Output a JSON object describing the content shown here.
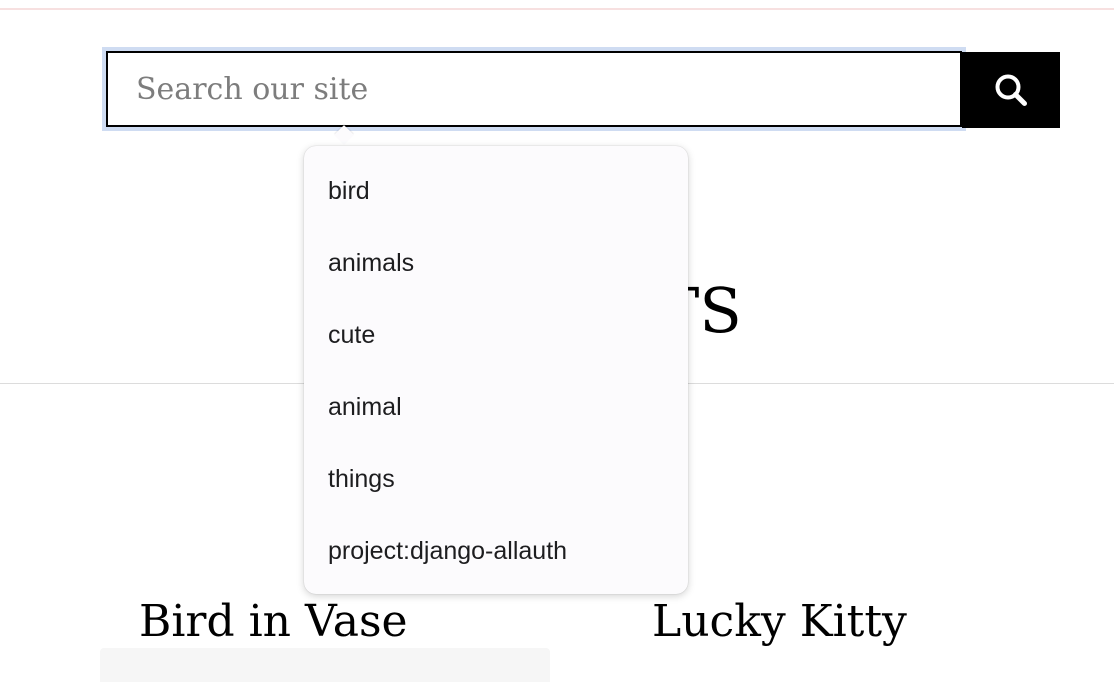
{
  "search": {
    "placeholder": "Search our site",
    "value": "",
    "button_icon": "search-icon"
  },
  "autocomplete": {
    "items": [
      {
        "label": "bird"
      },
      {
        "label": "animals"
      },
      {
        "label": "cute"
      },
      {
        "label": "animal"
      },
      {
        "label": "things"
      },
      {
        "label": "project:django-allauth"
      }
    ]
  },
  "page": {
    "heading_visible_fragment": "TS"
  },
  "cards": [
    {
      "title": "Bird in Vase"
    },
    {
      "title": "Lucky Kitty"
    }
  ],
  "colors": {
    "focus_ring": "#cfdcf2",
    "button_bg": "#000000",
    "dropdown_bg": "#fcfbfd",
    "divider": "#dcdcdc",
    "top_strip": "#f7e0e0"
  }
}
